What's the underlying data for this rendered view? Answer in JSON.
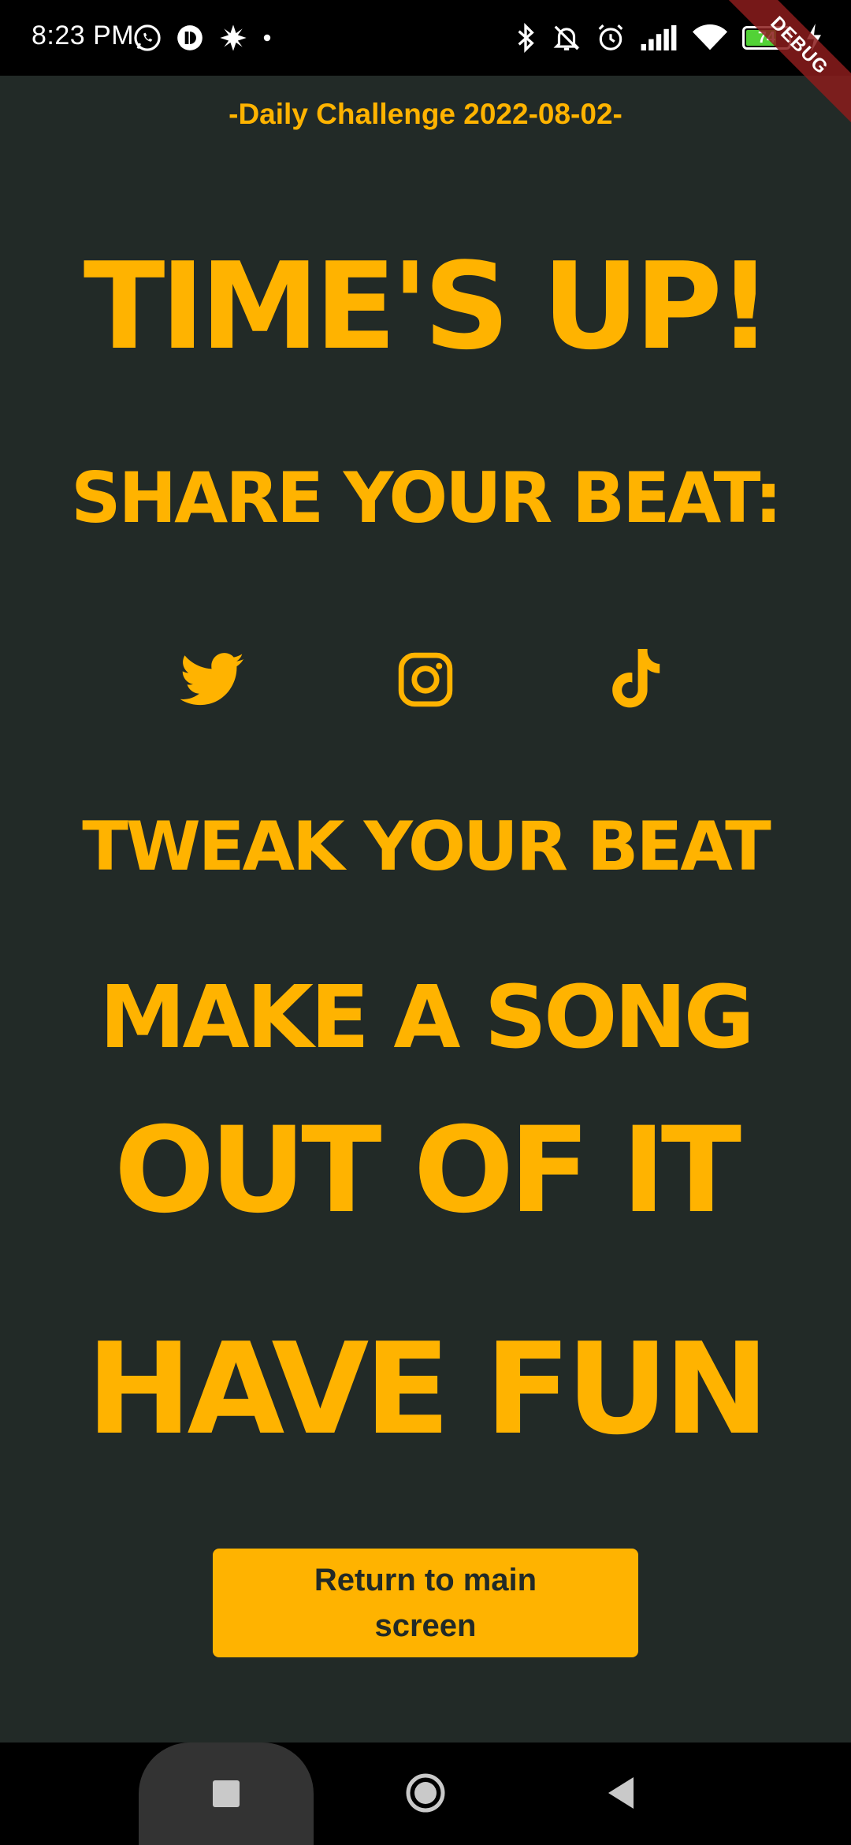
{
  "status_bar": {
    "time": "8:23 PM",
    "left_icons": [
      "whatsapp-icon",
      "app-notification-icon",
      "pinwheel-icon",
      "dot-icon"
    ],
    "right_icons": [
      "bluetooth-icon",
      "bell-off-icon",
      "alarm-icon",
      "signal-icon",
      "wifi-icon",
      "battery-icon",
      "charging-icon"
    ],
    "battery_level": "74",
    "battery_fraction": 0.74,
    "battery_color": "#52d236"
  },
  "debug_banner": "DEBUG",
  "challenge": {
    "subtitle": "-Daily Challenge 2022-08-02-"
  },
  "headlines": {
    "times_up": "TIME'S UP!",
    "share": "SHARE YOUR BEAT:",
    "tweak": "TWEAK YOUR BEAT",
    "make_song": "MAKE A SONG",
    "out_of_it": "OUT OF IT",
    "have_fun": "HAVE FUN"
  },
  "social": {
    "items": [
      "twitter-icon",
      "instagram-icon",
      "tiktok-icon"
    ]
  },
  "return_button": {
    "label": "Return to main screen"
  },
  "nav_bar": {
    "items": [
      "recents-button",
      "home-button",
      "back-button"
    ]
  },
  "colors": {
    "accent": "#ffb300",
    "background": "#222a27",
    "status_bar": "#000000"
  }
}
